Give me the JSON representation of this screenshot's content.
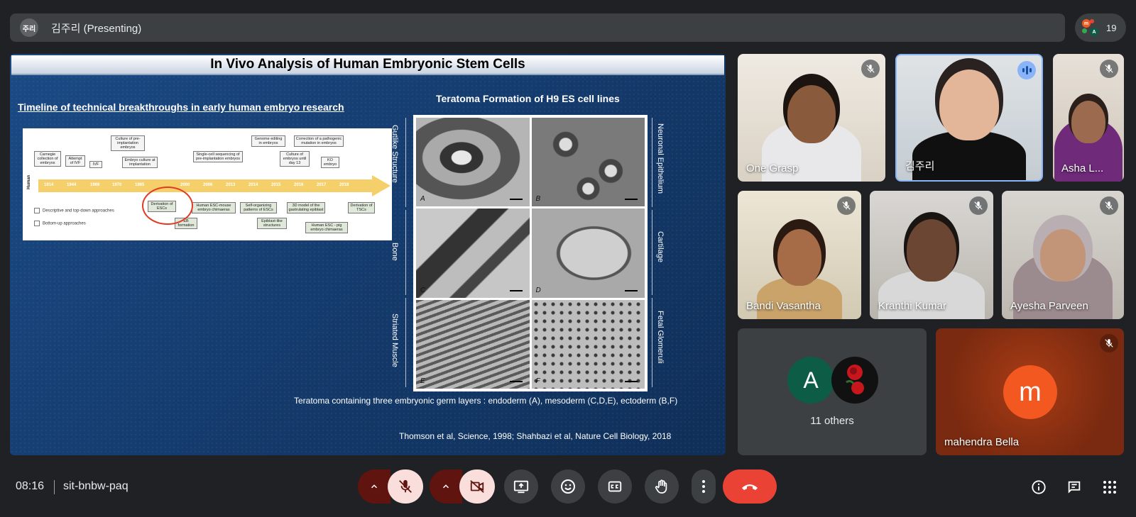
{
  "topbar": {
    "presenter_initials": "주리",
    "presenter_label": "김주리 (Presenting)",
    "participant_count": "19",
    "mini_avatar_initials": [
      "m",
      "A"
    ]
  },
  "slide": {
    "title": "In Vivo Analysis of Human Embryonic Stem Cells",
    "timeline_heading": "Timeline of technical breakthroughs in early human embryo research",
    "teratoma_heading": "Teratoma Formation of H9 ES cell lines",
    "caption": "Teratoma containing  three embryonic germ layers : endoderm (A), mesoderm (C,D,E), ectoderm (B,F)",
    "citation": "Thomson et al, Science, 1998; Shahbazi et al, Nature Cell Biology, 2018",
    "left_labels": [
      "Gutlike Structure",
      "Bone",
      "Striated Muscle"
    ],
    "right_labels": [
      "Neuronal Epithelium",
      "Cartilage",
      "Fetal Glomeruli"
    ],
    "panel_letters": [
      "A",
      "B",
      "C",
      "D",
      "E",
      "F"
    ],
    "timeline": {
      "axis_label": "Human",
      "years": [
        "1914",
        "1944",
        "1969",
        "1970",
        "1985",
        "2000",
        "2006",
        "2013",
        "2014",
        "2015",
        "2016",
        "2017",
        "2018"
      ],
      "top_boxes": [
        "Carnegie collection of embryos",
        "Attempt of IVF",
        "IVF",
        "Culture of pre-implantation embryos",
        "Embryo culture at implantation",
        "Single-cell sequencing of pre-implantation embryos",
        "Genome editing in embryos",
        "Culture of embryos until day 13",
        "Correction of a pathogenic mutation in embryos",
        "KO embryo"
      ],
      "bottom_boxes": [
        "Derivation of ESCs",
        "EB formation",
        "Human ESC-mouse embryo chimaeras",
        "Self-organizing patterns of ESCs",
        "Epiblast-like structures",
        "3D model of the gastrulating epiblast",
        "Human ESC - pig embryo chimaeras",
        "Derivation of TSCs"
      ],
      "legend": [
        "Descriptive and top-down approaches",
        "Bottom-up approaches"
      ]
    }
  },
  "participants": [
    {
      "name": "One Grasp",
      "muted": true
    },
    {
      "name": "김주리",
      "muted": false,
      "speaking": true
    },
    {
      "name": "Asha L...",
      "muted": true
    },
    {
      "name": "Bandi Vasantha",
      "muted": true
    },
    {
      "name": "Kranthi Kumar",
      "muted": true
    },
    {
      "name": "Ayesha Parveen",
      "muted": true
    }
  ],
  "others": {
    "label": "11 others",
    "initial": "A",
    "avatar_color": "#0d5c45"
  },
  "mahendra": {
    "name": "mahendra Bella",
    "initial": "m",
    "avatar_color": "#f2581f"
  },
  "bottombar": {
    "time": "08:16",
    "meeting_code": "sit-bnbw-paq"
  },
  "colors": {
    "background": "#202124",
    "surface": "#3c4043",
    "danger": "#ea4335",
    "accent": "#8ab4f8"
  }
}
